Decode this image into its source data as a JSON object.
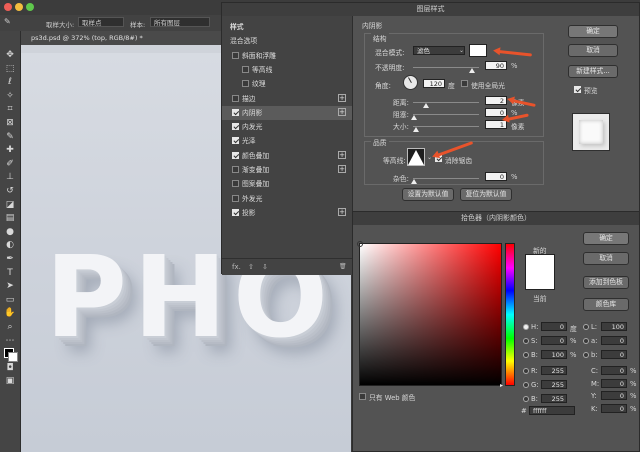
{
  "app": {
    "doc_tab": "ps3d.psd @ 372% (top, RGB/8#) *"
  },
  "optionbar": {
    "sample_size_label": "取样大小:",
    "sample_size_value": "取样点",
    "sample_label": "样本:",
    "sample_value": "所有图层"
  },
  "canvas": {
    "text": "PHO"
  },
  "toolbox": {
    "icons": [
      "move-icon",
      "marquee-icon",
      "lasso-icon",
      "quick-select-icon",
      "crop-icon",
      "frame-icon",
      "eyedropper-icon",
      "healing-icon",
      "brush-icon",
      "stamp-icon",
      "history-brush-icon",
      "eraser-icon",
      "gradient-icon",
      "blur-icon",
      "dodge-icon",
      "pen-icon",
      "type-icon",
      "path-select-icon",
      "shape-icon",
      "hand-icon",
      "zoom-icon",
      "more-icon",
      "color-swatch",
      "quick-mask-icon",
      "screen-mode-icon"
    ]
  },
  "layer_style": {
    "title": "图层样式",
    "list": [
      {
        "label": "样式",
        "checkbox": false,
        "plus": false,
        "checked": false,
        "indent": 0,
        "bold": true
      },
      {
        "label": "混合选项",
        "checkbox": false,
        "plus": false,
        "checked": false,
        "indent": 0
      },
      {
        "label": "斜面和浮雕",
        "checkbox": true,
        "plus": false,
        "checked": false,
        "indent": 0
      },
      {
        "label": "等高线",
        "checkbox": true,
        "plus": false,
        "checked": false,
        "indent": 1
      },
      {
        "label": "纹理",
        "checkbox": true,
        "plus": false,
        "checked": false,
        "indent": 1
      },
      {
        "label": "描边",
        "checkbox": true,
        "plus": true,
        "checked": false,
        "indent": 0
      },
      {
        "label": "内阴影",
        "checkbox": true,
        "plus": true,
        "checked": true,
        "indent": 0,
        "selected": true
      },
      {
        "label": "内发光",
        "checkbox": true,
        "plus": false,
        "checked": true,
        "indent": 0
      },
      {
        "label": "光泽",
        "checkbox": true,
        "plus": false,
        "checked": true,
        "indent": 0
      },
      {
        "label": "颜色叠加",
        "checkbox": true,
        "plus": true,
        "checked": true,
        "indent": 0
      },
      {
        "label": "渐变叠加",
        "checkbox": true,
        "plus": true,
        "checked": false,
        "indent": 0
      },
      {
        "label": "图案叠加",
        "checkbox": true,
        "plus": false,
        "checked": false,
        "indent": 0
      },
      {
        "label": "外发光",
        "checkbox": true,
        "plus": false,
        "checked": false,
        "indent": 0
      },
      {
        "label": "投影",
        "checkbox": true,
        "plus": true,
        "checked": true,
        "indent": 0
      }
    ],
    "footer": {
      "fx": "fx.",
      "up": "⇧",
      "down": "⇩",
      "trash": "🗑"
    },
    "inner_shadow": {
      "heading": "内阴影",
      "structure": "结构",
      "blend_mode_label": "混合模式:",
      "blend_mode_value": "滤色",
      "opacity_label": "不透明度:",
      "opacity_value": "90",
      "opacity_unit": "%",
      "opacity_fraction": 0.9,
      "angle_label": "角度:",
      "angle_value": "120",
      "angle_unit": "度",
      "global_light_label": "使用全局光",
      "distance_label": "距离:",
      "distance_value": "2",
      "distance_unit": "像素",
      "choke_label": "阻塞:",
      "choke_value": "0",
      "choke_unit": "%",
      "size_label": "大小:",
      "size_value": "1",
      "size_unit": "像素",
      "quality": "品质",
      "contour_label": "等高线:",
      "antialias_label": "消除锯齿",
      "noise_label": "杂色:",
      "noise_value": "0",
      "noise_unit": "%",
      "set_default": "设置为默认值",
      "reset_default": "复位为默认值",
      "shadow_color": "#ffffff"
    },
    "buttons": {
      "ok": "确定",
      "cancel": "取消",
      "new_style": "新建样式...",
      "preview": "预览"
    }
  },
  "color_picker": {
    "title": "拾色器（内阴影颜色）",
    "new_label": "新的",
    "current_label": "当前",
    "ok": "确定",
    "cancel": "取消",
    "add_swatch": "添加到色板",
    "libraries": "颜色库",
    "web_only": "只有 Web 颜色",
    "hsb": [
      {
        "l": "H:",
        "v": "0",
        "u": "度"
      },
      {
        "l": "S:",
        "v": "0",
        "u": "%"
      },
      {
        "l": "B:",
        "v": "100",
        "u": "%"
      }
    ],
    "rgb": [
      {
        "l": "R:",
        "v": "255"
      },
      {
        "l": "G:",
        "v": "255"
      },
      {
        "l": "B:",
        "v": "255"
      }
    ],
    "lab": [
      {
        "l": "L:",
        "v": "100"
      },
      {
        "l": "a:",
        "v": "0"
      },
      {
        "l": "b:",
        "v": "0"
      }
    ],
    "cmyk": [
      {
        "l": "C:",
        "v": "0",
        "u": "%"
      },
      {
        "l": "M:",
        "v": "0",
        "u": "%"
      },
      {
        "l": "Y:",
        "v": "0",
        "u": "%"
      },
      {
        "l": "K:",
        "v": "0",
        "u": "%"
      }
    ],
    "hex_label": "#",
    "hex_value": "ffffff",
    "current_color": "#ffffff"
  },
  "colors": {
    "annotation_arrow": "#e8532b"
  }
}
